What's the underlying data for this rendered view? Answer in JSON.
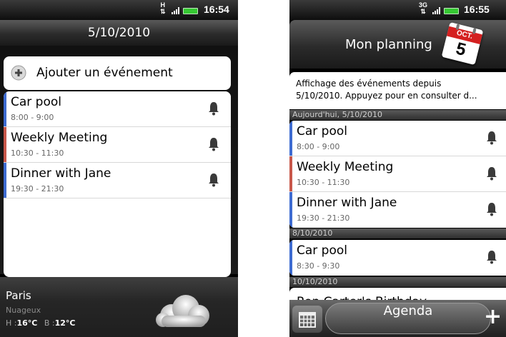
{
  "left_screen": {
    "status": {
      "network": "H",
      "time": "16:54"
    },
    "header": {
      "date": "5/10/2010"
    },
    "add_event_label": "Ajouter un événement",
    "events": [
      {
        "title": "Car pool",
        "time": "8:00 - 9:00",
        "color": "#3d6bd1"
      },
      {
        "title": "Weekly Meeting",
        "time": "10:30 - 11:30",
        "color": "#c8574a"
      },
      {
        "title": "Dinner with Jane",
        "time": "19:30 - 21:30",
        "color": "#3d6bd1"
      }
    ],
    "weather": {
      "city": "Paris",
      "condition": "Nuageux",
      "high_label": "H :",
      "high": "16°C",
      "low_label": "B :",
      "low": "12°C",
      "icon": "cloud-icon"
    }
  },
  "right_screen": {
    "status": {
      "network": "3G",
      "time": "16:55"
    },
    "header": {
      "title": "Mon planning",
      "calendar_month": "OCT.",
      "calendar_day": "5"
    },
    "info_banner": {
      "line1": "Affichage des événements depuis",
      "line2": "5/10/2010. Appuyez pour en consulter d..."
    },
    "sections": [
      {
        "label": "Aujourd'hui, 5/10/2010",
        "events": [
          {
            "title": "Car pool",
            "time": "8:00 - 9:00",
            "color": "#3d6bd1"
          },
          {
            "title": "Weekly Meeting",
            "time": "10:30 - 11:30",
            "color": "#c8574a"
          },
          {
            "title": "Dinner with Jane",
            "time": "19:30 - 21:30",
            "color": "#3d6bd1"
          }
        ]
      },
      {
        "label": "8/10/2010",
        "events": [
          {
            "title": "Car pool",
            "time": "8:30 - 9:30",
            "color": "#3d6bd1"
          }
        ]
      },
      {
        "label": "10/10/2010",
        "events": [
          {
            "title": "Ron Carter's Birthday"
          }
        ]
      }
    ],
    "bottom_bar": {
      "view_label": "Agenda",
      "add_symbol": "+"
    }
  }
}
